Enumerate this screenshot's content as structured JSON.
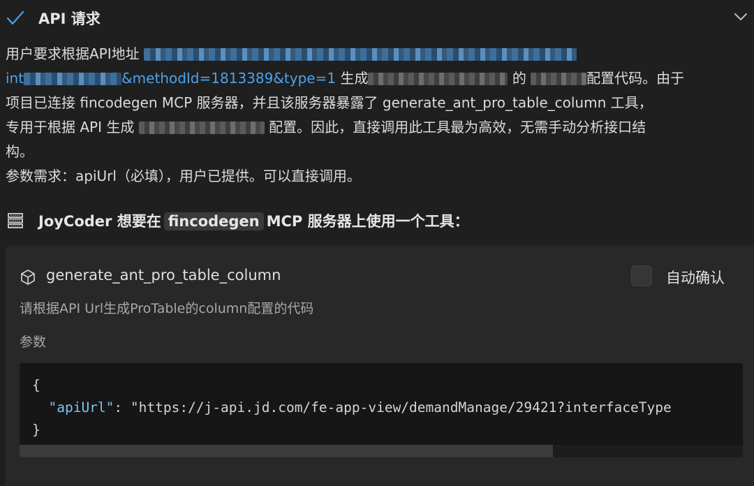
{
  "header": {
    "title": "API 请求",
    "check_icon": "check-icon",
    "collapse_icon": "chevron-down-icon"
  },
  "message": {
    "line1_prefix": "用户要求根据API地址",
    "line2_link_prefix": "int",
    "line2_link_suffix": "&methodId=1813389&type=1",
    "line2_text_a": "生成",
    "line2_text_b": "的",
    "line2_text_c": "配置代码。由于",
    "line3": "项目已连接 fincodegen MCP 服务器，并且该服务器暴露了 generate_ant_pro_table_column 工具，",
    "line4_a": "专用于根据 API 生成",
    "line4_b": "配置。因此，直接调用此工具最为高效，无需手动分析接口结",
    "line5": "构。",
    "line6": "参数需求：apiUrl（必填），用户已提供。可以直接调用。"
  },
  "tool_request": {
    "icon": "server-icon",
    "prefix": "JoyCoder 想要在",
    "server_name": "fincodegen",
    "suffix": "MCP 服务器上使用一个工具："
  },
  "tool_card": {
    "icon": "cube-icon",
    "tool_name": "generate_ant_pro_table_column",
    "auto_confirm_label": "自动确认",
    "auto_confirm_checked": false,
    "description": "请根据API Url生成ProTable的column配置的代码",
    "params_label": "参数",
    "code": {
      "open": "{",
      "key": "\"apiUrl\"",
      "colon": ": ",
      "value": "\"https://j-api.jd.com/fe-app-view/demandManage/29421?interfaceType",
      "close": "}"
    },
    "scroll_position": 0.0
  },
  "colors": {
    "background": "#1f1f1f",
    "card": "#282828",
    "link": "#4aa3f0",
    "accent": "#4aa3f0"
  }
}
